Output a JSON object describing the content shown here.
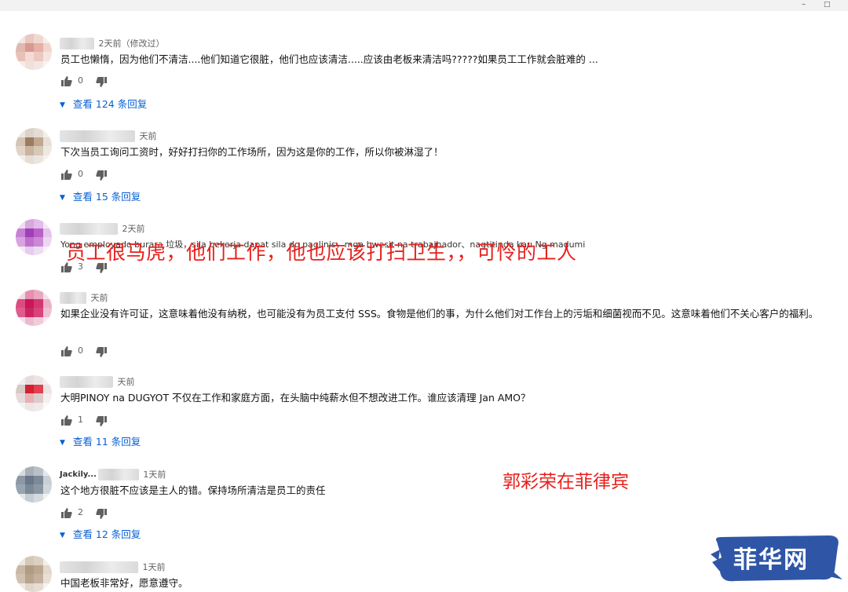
{
  "window": {
    "minimize_glyph": "–",
    "maximize_glyph": "□"
  },
  "comments": [
    {
      "time": "2天前（修改过）",
      "text": "员工也懒惰，因为他们不清洁....他们知道它很脏，他们也应该清洁.....应该由老板来清洁吗?????如果员工工作就会脏难的 ...",
      "likes": "0",
      "replies": "查看 124 条回复",
      "avatar_colors": [
        "#f2e4e0",
        "#e8c8c0",
        "#f0d8d0",
        "#f8ece8",
        "#e0b8b0",
        "#d89890",
        "#e6b0a6",
        "#f0d4ce",
        "#e8c0b8",
        "#f4dcd4",
        "#ecc8c0",
        "#f6e4e0",
        "#f6ecea",
        "#f0e0dc",
        "#f2e6e2",
        "#faf2f0"
      ]
    },
    {
      "time": "天前",
      "text": "下次当员工询问工资时，好好打扫你的工作场所，因为这是你的工作，所以你被淋湿了！",
      "likes": "0",
      "replies": "查看 15 条回复",
      "avatar_colors": [
        "#ece6e0",
        "#dcd2c8",
        "#e4dcd4",
        "#f2eeea",
        "#d4c4b4",
        "#9c7c60",
        "#c0a890",
        "#e8e0d8",
        "#e0d4c8",
        "#c8b4a0",
        "#d8c8b8",
        "#eee8e2",
        "#f2eeea",
        "#e6ded6",
        "#ebe5df",
        "#f6f2ee"
      ]
    },
    {
      "time": "2天前",
      "text": "Yong employado burara 垃圾，sila bekerja dapat sila do paglinis，mga bwesit na trabajhador、nagtitinda kau Ng madumi",
      "overlay": "员工很马虎，他们工作，他也应该打扫卫生，，可怜的工人",
      "likes": "3",
      "replies": null,
      "avatar_colors": [
        "#eedcf2",
        "#d8a8e0",
        "#e2bcea",
        "#f4e8f6",
        "#c880d4",
        "#a040b8",
        "#b860c8",
        "#e4c4ec",
        "#d8a4e0",
        "#c070cc",
        "#cc88d6",
        "#ecd6f0",
        "#f4e8f6",
        "#e6ccec",
        "#eedcf2",
        "#f8f0fa"
      ]
    },
    {
      "time": "天前",
      "text": "如果企业没有许可证，这意味着他没有纳税，也可能没有为员工支付 SSS。食物是他们的事，为什么他们对工作台上的污垢和细菌视而不见。这意味着他们不关心客户的福利。",
      "likes": "0",
      "replies": null,
      "avatar_colors": [
        "#f2d8e2",
        "#e490b0",
        "#ea a8c0",
        "#f6e0e8",
        "#dc4c80",
        "#c81858",
        "#d43670",
        "#ecb0c8",
        "#e05c8c",
        "#cc2462",
        "#d84478",
        "#eec0d2",
        "#f6e0ea",
        "#ecbad0",
        "#f0ccda",
        "#fae8f0"
      ]
    },
    {
      "time": "天前",
      "text": "大明PINOY na DUGYOT 不仅在工作和家庭方面，在头脑中纯薪水但不想改进工作。谁应该清理 Jan AMO？",
      "likes": "1",
      "replies": "查看 11 条回复",
      "avatar_colors": [
        "#f2eeee",
        "#e6dcdc",
        "#ece4e4",
        "#f6f2f2",
        "#d8c8c8",
        "#d42030",
        "#e04050",
        "#ece4e4",
        "#e6dada",
        "#e8b0b4",
        "#dccccc",
        "#f4f0f0",
        "#f6f2f2",
        "#ece6e6",
        "#f0eaea",
        "#faf8f8"
      ]
    },
    {
      "name": "Jackily...",
      "time": "1天前",
      "text": "这个地方很脏不应该是主人的错。保持场所清洁是员工的责任",
      "likes": "2",
      "replies": "查看 12 条回复",
      "avatar_colors": [
        "#d8dce0",
        "#a8b0b8",
        "#b8c0c8",
        "#e4e8ec",
        "#8c98a4",
        "#68788a",
        "#7c8a98",
        "#c8d0d6",
        "#98a4b0",
        "#7a8896",
        "#8a96a2",
        "#d0d6dc",
        "#e2e6ea",
        "#c4ccd4",
        "#d4dae0",
        "#eef0f2"
      ]
    },
    {
      "time": "1天前",
      "text": "中国老板非常好，愿意遵守。",
      "likes": null,
      "replies": null,
      "avatar_colors": [
        "#ece6de",
        "#d4c8b8",
        "#dcd0c2",
        "#f2eee8",
        "#c8b8a4",
        "#b09c84",
        "#bca890",
        "#e2d8cc",
        "#d0c2b0",
        "#b8a48e",
        "#c4b29e",
        "#e8e0d6",
        "#f0eae4",
        "#e0d6ca",
        "#e6ded4",
        "#f6f2ee"
      ]
    }
  ],
  "watermark_author": "郭彩荣在菲律宾",
  "logo": {
    "text": "菲华网",
    "color": "#2f56a6"
  }
}
